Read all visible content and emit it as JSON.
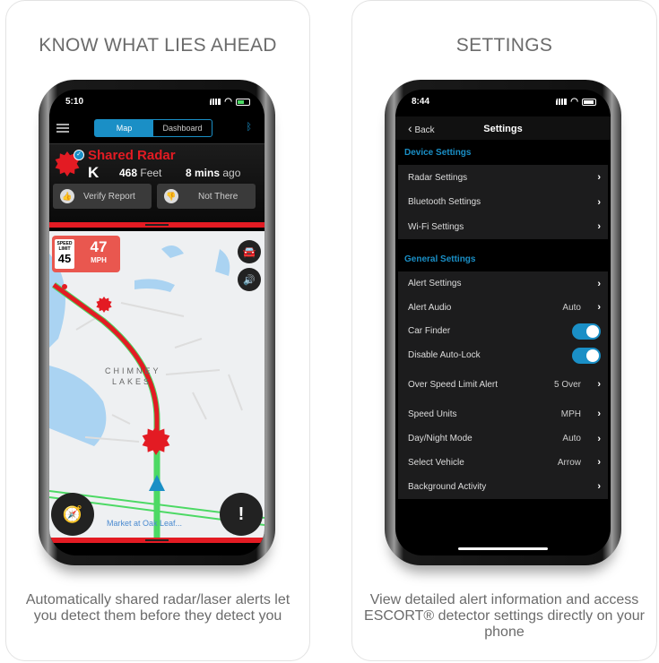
{
  "left_card": {
    "title": "KNOW WHAT LIES AHEAD",
    "caption": "Automatically shared radar/laser alerts let you detect them before they detect you"
  },
  "right_card": {
    "title": "SETTINGS",
    "caption": "View detailed alert information and access ESCORT® detector settings directly on your phone"
  },
  "map_phone": {
    "status_time": "5:10",
    "tabs": [
      {
        "label": "Map",
        "active": true
      },
      {
        "label": "Dashboard",
        "active": false
      }
    ],
    "alert": {
      "title": "Shared Radar",
      "band": "K",
      "distance": "468",
      "distance_unit": "Feet",
      "time": "8 mins",
      "time_suffix": "ago"
    },
    "buttons": {
      "verify": "Verify Report",
      "not_there": "Not There"
    },
    "speed_limit": {
      "label": "SPEED LIMIT",
      "value": "45"
    },
    "current_speed": {
      "value": "47",
      "unit": "MPH"
    },
    "map": {
      "area_label": "CHIMNEY LAKES",
      "poi": "Market at Oak Leaf..."
    },
    "colors": {
      "accent": "#1a8fc6",
      "alert": "#e31b23"
    }
  },
  "settings_phone": {
    "status_time": "8:44",
    "back_label": "Back",
    "title": "Settings",
    "device_header": "Device Settings",
    "device_items": [
      {
        "label": "Radar Settings"
      },
      {
        "label": "Bluetooth Settings"
      },
      {
        "label": "Wi-Fi Settings"
      }
    ],
    "general_header": "General Settings",
    "general_items": [
      {
        "label": "Alert Settings",
        "value": ""
      },
      {
        "label": "Alert Audio",
        "value": "Auto"
      },
      {
        "label": "Car Finder",
        "toggle": true
      },
      {
        "label": "Disable Auto-Lock",
        "toggle": true
      },
      {
        "label": "Over Speed Limit Alert",
        "value": "5 Over"
      },
      {
        "label": "Speed Units",
        "value": "MPH"
      },
      {
        "label": "Day/Night Mode",
        "value": "Auto"
      },
      {
        "label": "Select Vehicle",
        "value": "Arrow"
      },
      {
        "label": "Background Activity",
        "value": ""
      }
    ]
  }
}
